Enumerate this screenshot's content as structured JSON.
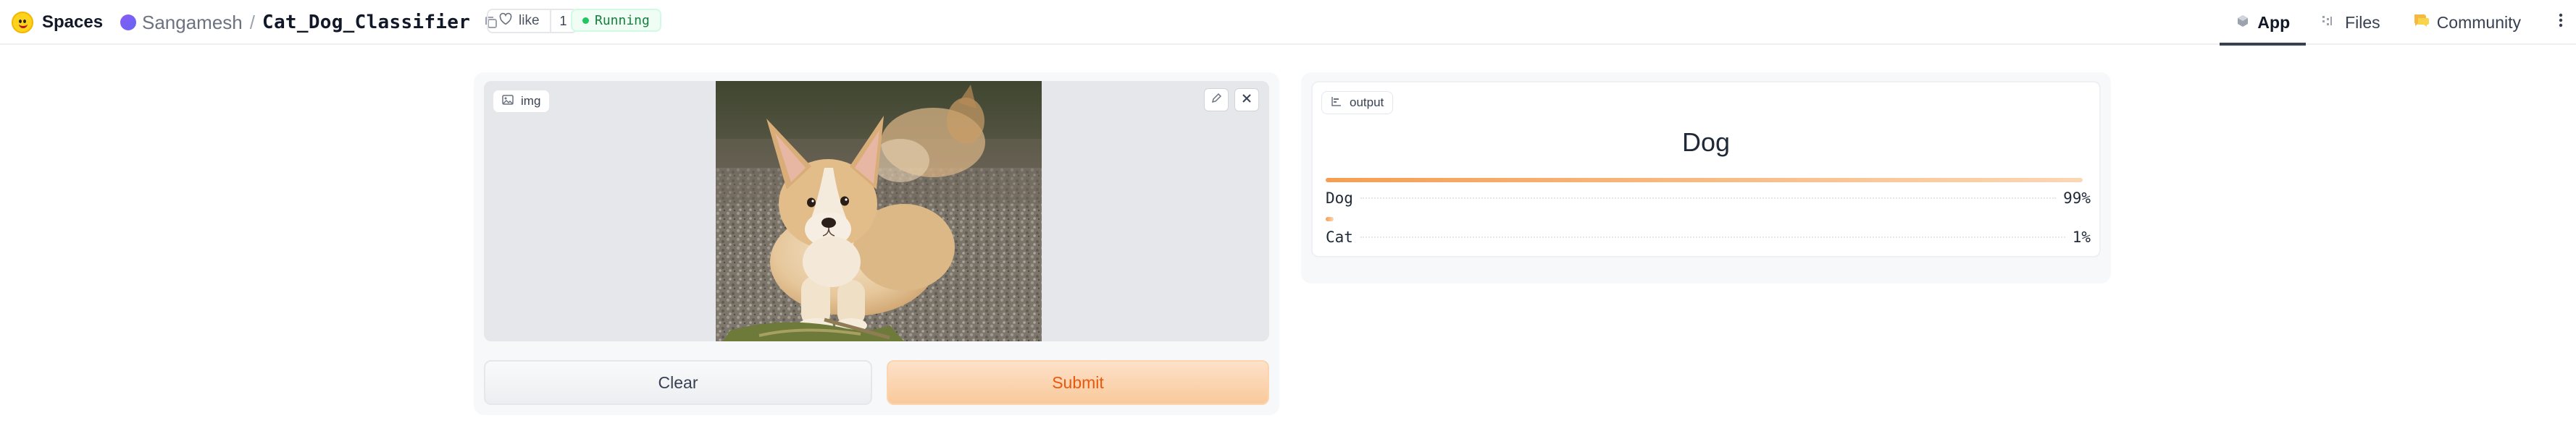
{
  "header": {
    "brand": "Spaces",
    "owner": "Sangamesh",
    "separator": "/",
    "repo_name": "Cat_Dog_Classifier",
    "like_label": "like",
    "like_count": "1",
    "status": "Running",
    "nav": [
      {
        "label": "App",
        "icon": "app-cube-icon",
        "active": true
      },
      {
        "label": "Files",
        "icon": "files-icon",
        "active": false
      },
      {
        "label": "Community",
        "icon": "community-icon",
        "active": false
      }
    ]
  },
  "input": {
    "label": "img",
    "image_subject": "corgi puppy"
  },
  "buttons": {
    "clear": "Clear",
    "submit": "Submit"
  },
  "output": {
    "label": "output",
    "prediction": "Dog",
    "confidences": [
      {
        "label": "Dog",
        "value_text": "99%",
        "fraction": 0.99
      },
      {
        "label": "Cat",
        "value_text": "1%",
        "fraction": 0.01
      }
    ]
  },
  "colors": {
    "accent": "#ea580c",
    "submit_bg": "#f9c99b",
    "running": "#22c55e",
    "bar": "#f59e52"
  }
}
